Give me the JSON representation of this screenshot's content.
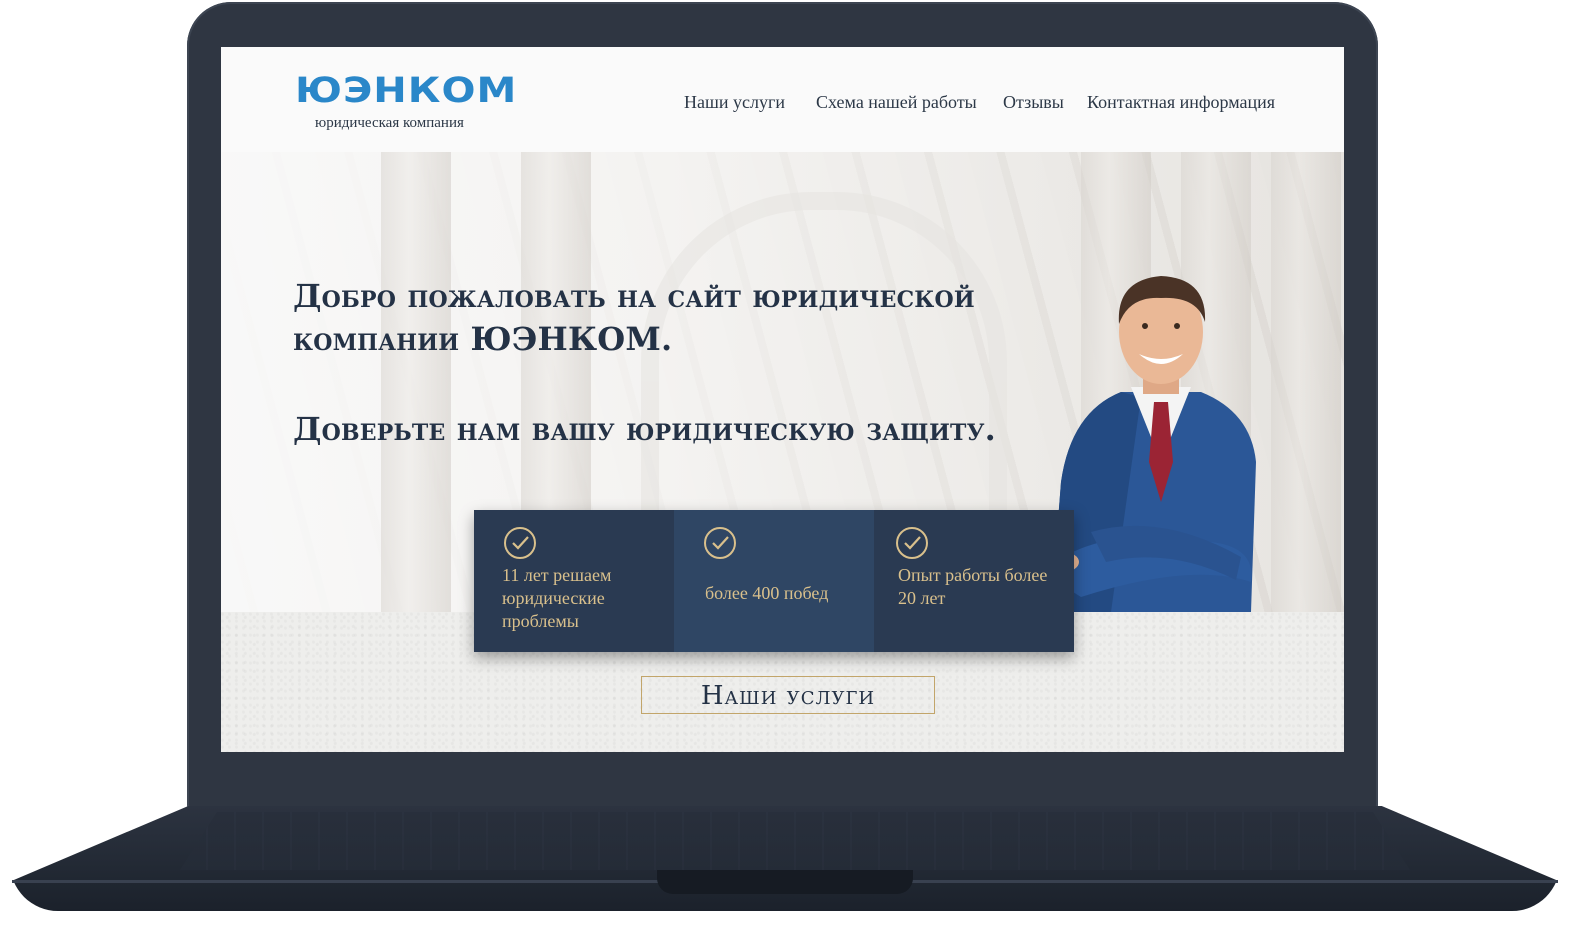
{
  "brand": {
    "name": "ЮЭНКОМ",
    "tagline": "юридическая компания",
    "color": "#2a87c9"
  },
  "nav": {
    "items": [
      {
        "label": "Наши услуги"
      },
      {
        "label": "Схема нашей работы"
      },
      {
        "label": "Отзывы"
      },
      {
        "label": "Контактная информация"
      }
    ]
  },
  "hero": {
    "welcome": "Добро пожаловать на сайт юридической компании ЮЭНКОМ.",
    "trust": "Доверьте нам вашу юридическую защиту."
  },
  "stats": [
    {
      "icon": "check-circle-icon",
      "text": "11 лет решаем юридические проблемы"
    },
    {
      "icon": "check-circle-icon",
      "text": "более 400 побед"
    },
    {
      "icon": "check-circle-icon",
      "text": "Опыт работы более 20 лет"
    }
  ],
  "cta": {
    "label": "Наши услуги"
  },
  "colors": {
    "navy": "#243246",
    "card_dark": "#2a3a52",
    "card_mid": "#2f4664",
    "gold": "#d9c08c",
    "device": "#2f3642"
  }
}
